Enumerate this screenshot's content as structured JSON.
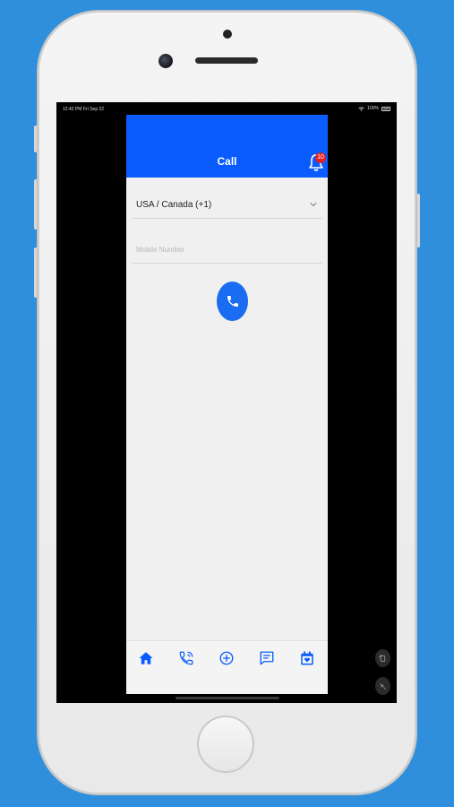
{
  "status_bar": {
    "time": "12:42 PM",
    "date": "Fri Sep 22",
    "battery": "100%"
  },
  "header": {
    "title": "Call",
    "notification_count": "10"
  },
  "form": {
    "country_selected": "USA / Canada (+1)",
    "mobile_placeholder": "Mobile Number",
    "mobile_value": ""
  },
  "tabbar": {
    "items": [
      {
        "icon": "home-icon"
      },
      {
        "icon": "phone-call-icon"
      },
      {
        "icon": "add-circle-icon"
      },
      {
        "icon": "message-icon"
      },
      {
        "icon": "calendar-icon"
      }
    ]
  },
  "colors": {
    "background": "#2f8fdc",
    "accent": "#0a5cff",
    "badge": "#e82020",
    "app_background": "#f0f0f0"
  }
}
